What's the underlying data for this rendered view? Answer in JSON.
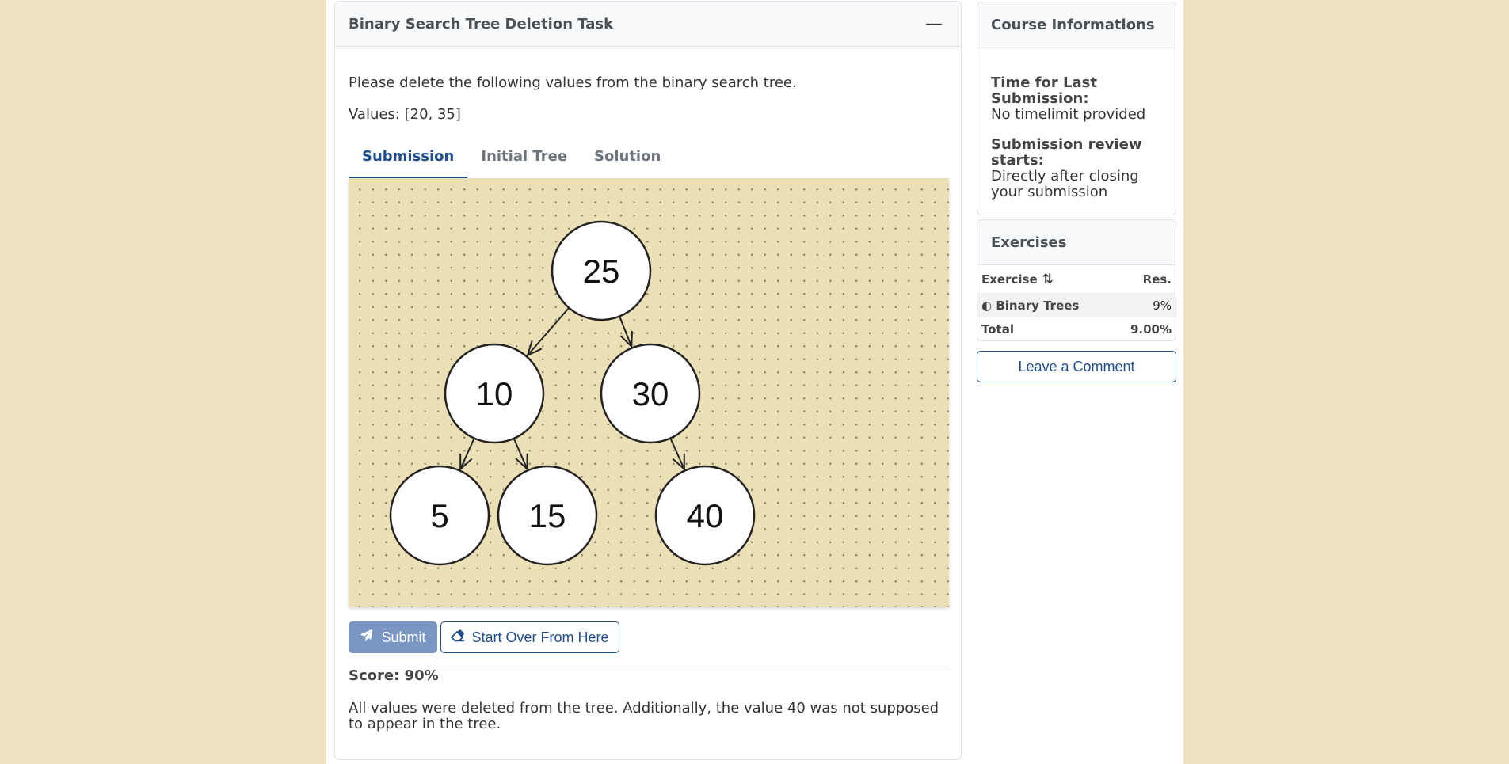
{
  "task": {
    "title": "Binary Search Tree Deletion Task",
    "collapse_symbol": "—",
    "prompt": "Please delete the following values from the binary search tree.",
    "values_text": "Values: [20, 35]",
    "tabs": [
      {
        "label": "Submission",
        "active": true
      },
      {
        "label": "Initial Tree",
        "active": false
      },
      {
        "label": "Solution",
        "active": false
      }
    ],
    "tree": {
      "nodes": [
        {
          "value": "25"
        },
        {
          "value": "10"
        },
        {
          "value": "30"
        },
        {
          "value": "5"
        },
        {
          "value": "15"
        },
        {
          "value": "40"
        }
      ],
      "edges": [
        [
          "25",
          "10"
        ],
        [
          "25",
          "30"
        ],
        [
          "10",
          "5"
        ],
        [
          "10",
          "15"
        ],
        [
          "30",
          "40"
        ]
      ]
    },
    "submit_label": "Submit",
    "start_over_label": "Start Over From Here",
    "score_text": "Score: 90%",
    "feedback": "All values were deleted from the tree. Additionally, the value 40 was not supposed to appear in the tree."
  },
  "sidebar": {
    "course_info": {
      "title": "Course Informations",
      "last_submission_label": "Time for Last Submission:",
      "last_submission_value": "No timelimit provided",
      "review_label": "Submission review starts:",
      "review_value": "Directly after closing your submission"
    },
    "exercises": {
      "title": "Exercises",
      "col_exercise": "Exercise",
      "col_result": "Res.",
      "rows": [
        {
          "name": "Binary Trees",
          "result": "9%"
        }
      ],
      "total_label": "Total",
      "total_value": "9.00%"
    },
    "comment_label": "Leave a Comment"
  },
  "colors": {
    "background": "#ede3c1",
    "canvas": "#ebdfb5",
    "accent": "#1f4e8c",
    "submit": "#7a97c4"
  }
}
